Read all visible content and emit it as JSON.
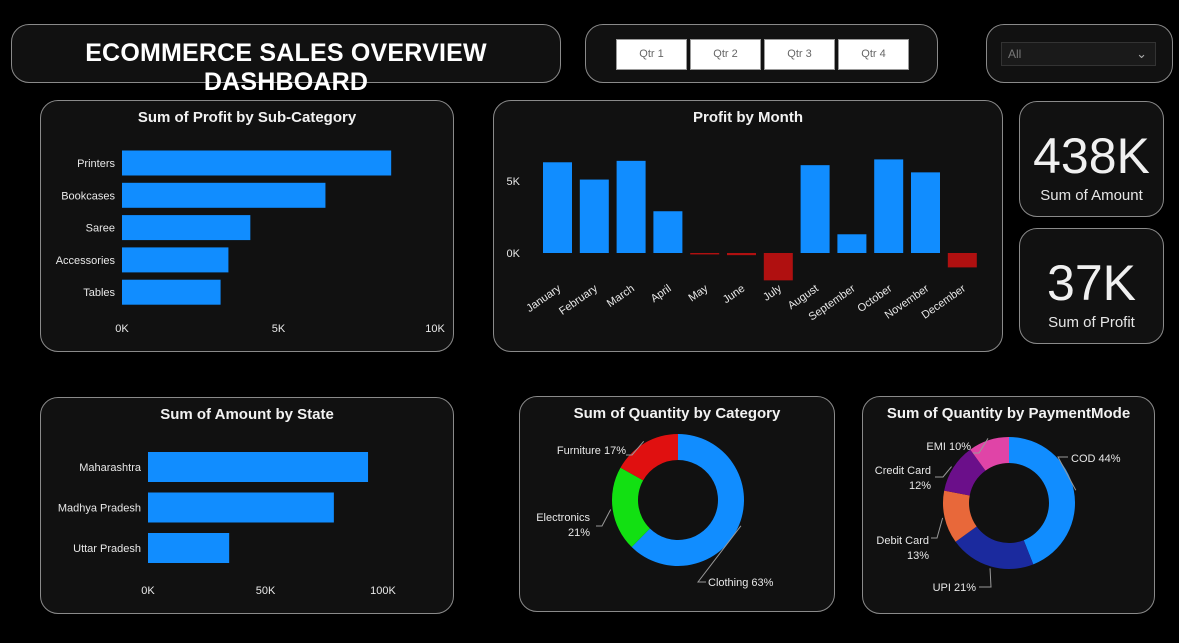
{
  "header": {
    "title": "ECOMMERCE SALES OVERVIEW DASHBOARD"
  },
  "quarter_slicer": {
    "buttons": [
      "Qtr 1",
      "Qtr 2",
      "Qtr 3",
      "Qtr 4"
    ]
  },
  "dropdown": {
    "selected": "All",
    "icon": "chevron-down-icon"
  },
  "kpis": [
    {
      "value": "438K",
      "label": "Sum of Amount"
    },
    {
      "value": "37K",
      "label": "Sum of Profit"
    }
  ],
  "colors": {
    "bar": "#118DFF",
    "negative": "#B01010",
    "furniture": "#E01010",
    "electronics": "#12E012",
    "clothing": "#118DFF",
    "cod": "#118DFF",
    "upi": "#1B2A9E",
    "debit": "#E8683A",
    "credit": "#6B0F8A",
    "emi": "#E044A7"
  },
  "chart_data": [
    {
      "type": "bar",
      "orientation": "horizontal",
      "title": "Sum of Profit by Sub-Category",
      "categories": [
        "Printers",
        "Bookcases",
        "Saree",
        "Accessories",
        "Tables"
      ],
      "values": [
        8600,
        6500,
        4100,
        3400,
        3150
      ],
      "xlim": [
        0,
        10000
      ],
      "ticks": [
        "0K",
        "5K",
        "10K"
      ],
      "grid": false
    },
    {
      "type": "bar",
      "title": "Profit by Month",
      "categories": [
        "January",
        "February",
        "March",
        "April",
        "May",
        "June",
        "July",
        "August",
        "September",
        "October",
        "November",
        "December"
      ],
      "values": [
        6300,
        5100,
        6400,
        2900,
        -100,
        -150,
        -1900,
        6100,
        1300,
        6500,
        5600,
        -1000
      ],
      "ticks": [
        "5K",
        "0K"
      ],
      "grid": false
    },
    {
      "type": "bar",
      "orientation": "horizontal",
      "title": "Sum of Amount by State",
      "categories": [
        "Maharashtra",
        "Madhya Pradesh",
        "Uttar Pradesh"
      ],
      "values": [
        103000,
        87000,
        38000
      ],
      "xlim": [
        0,
        110000
      ],
      "ticks": [
        "0K",
        "50K",
        "100K"
      ],
      "grid": false
    },
    {
      "type": "pie",
      "donut": true,
      "title": "Sum of Quantity by Category",
      "labels": [
        "Clothing",
        "Electronics",
        "Furniture"
      ],
      "values": [
        63,
        21,
        17
      ],
      "label_text": [
        "Clothing 63%",
        "Electronics\n21%",
        "Furniture 17%"
      ]
    },
    {
      "type": "pie",
      "donut": true,
      "title": "Sum of Quantity by PaymentMode",
      "labels": [
        "COD",
        "UPI",
        "Debit Card",
        "Credit Card",
        "EMI"
      ],
      "values": [
        44,
        21,
        13,
        12,
        10
      ],
      "label_text": [
        "COD 44%",
        "UPI 21%",
        "Debit Card\n13%",
        "Credit Card\n12%",
        "EMI 10%"
      ]
    }
  ]
}
